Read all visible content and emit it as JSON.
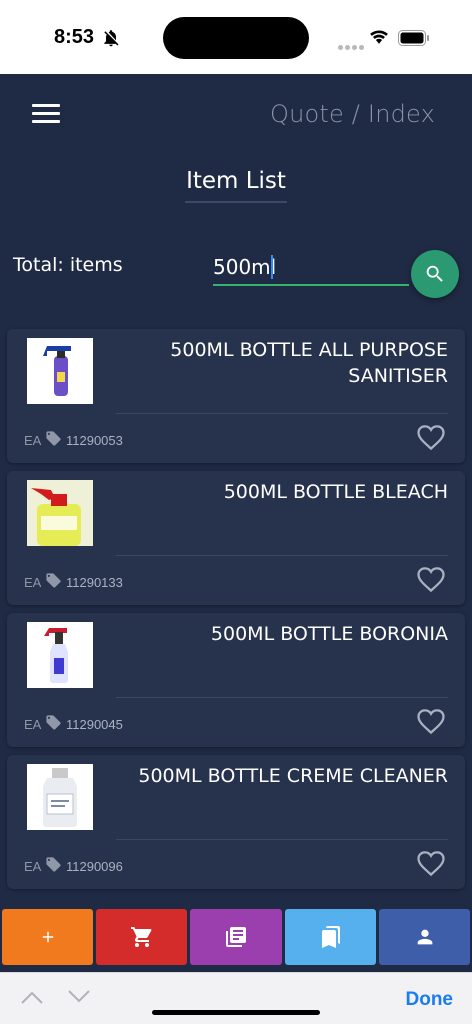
{
  "status": {
    "time": "8:53"
  },
  "header": {
    "breadcrumb": "Quote / Index",
    "title": "Item List"
  },
  "summary": {
    "total_label": "Total: items"
  },
  "search": {
    "value": "500ml"
  },
  "items": [
    {
      "name": "500ML BOTTLE ALL PURPOSE SANITISER",
      "uom": "EA",
      "code": "11290053",
      "thumb_colors": [
        "#1a3ea6",
        "#6b4fc7"
      ]
    },
    {
      "name": "500ML BOTTLE BLEACH",
      "uom": "EA",
      "code": "11290133",
      "thumb_colors": [
        "#d21c1c",
        "#e6ec55"
      ]
    },
    {
      "name": "500ML BOTTLE BORONIA",
      "uom": "EA",
      "code": "11290045",
      "thumb_colors": [
        "#c61e2e",
        "#3f3bd0"
      ]
    },
    {
      "name": "500ML BOTTLE CREME CLEANER",
      "uom": "EA",
      "code": "11290096",
      "thumb_colors": [
        "#c9c9c9",
        "#e9edf2"
      ]
    }
  ],
  "tabs": [
    {
      "name": "add",
      "icon": "plus-icon",
      "color": "#f07a1d"
    },
    {
      "name": "cart",
      "icon": "cart-icon",
      "color": "#d42b2b"
    },
    {
      "name": "catalog",
      "icon": "library-icon",
      "color": "#9b3fae"
    },
    {
      "name": "saved",
      "icon": "bookmarks-icon",
      "color": "#56b0ee"
    },
    {
      "name": "account",
      "icon": "person-icon",
      "color": "#3e5ea9"
    }
  ],
  "keyboard_accessory": {
    "done_label": "Done"
  },
  "colors": {
    "background": "#1f2a44",
    "card": "#27324d",
    "search_accent": "#2b9a72"
  }
}
